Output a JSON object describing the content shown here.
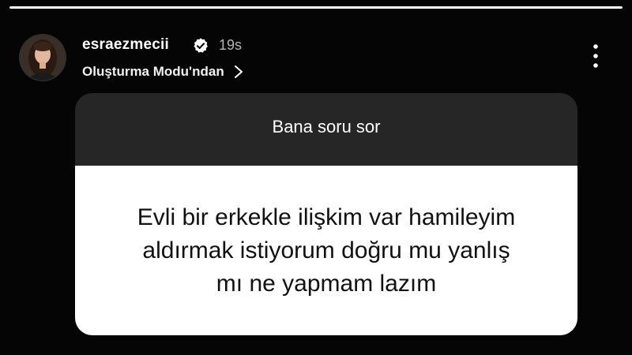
{
  "story": {
    "progress_fraction": 1.0
  },
  "header": {
    "username": "esraezmecii",
    "verified": true,
    "timestamp": "19s",
    "source_label": "Oluşturma Modu'ndan",
    "icons": {
      "verified": "verified-badge-icon",
      "source": "chevron-right-icon",
      "menu": "more-options-icon"
    }
  },
  "sticker": {
    "title": "Bana soru sor",
    "question_lines": [
      "Evli bir erkekle ilişkim var hamileyim",
      "aldırmak istiyorum doğru mu yanlış",
      "mı ne yapmam lazım"
    ],
    "header_color": "#262626",
    "body_color": "#ffffff"
  }
}
